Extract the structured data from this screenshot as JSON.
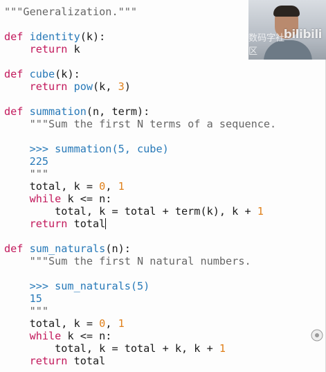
{
  "code_lines": [
    {
      "tokens": [
        {
          "c": "str",
          "t": "\"\"\"Generalization.\"\"\""
        }
      ]
    },
    {
      "tokens": []
    },
    {
      "tokens": [
        {
          "c": "kw",
          "t": "def "
        },
        {
          "c": "fn",
          "t": "identity"
        },
        {
          "c": "plain",
          "t": "(k):"
        }
      ]
    },
    {
      "tokens": [
        {
          "c": "kw",
          "t": "    return "
        },
        {
          "c": "plain",
          "t": "k"
        }
      ]
    },
    {
      "tokens": []
    },
    {
      "tokens": [
        {
          "c": "kw",
          "t": "def "
        },
        {
          "c": "fn",
          "t": "cube"
        },
        {
          "c": "plain",
          "t": "(k):"
        }
      ]
    },
    {
      "tokens": [
        {
          "c": "kw",
          "t": "    return "
        },
        {
          "c": "fn",
          "t": "pow"
        },
        {
          "c": "plain",
          "t": "(k, "
        },
        {
          "c": "num",
          "t": "3"
        },
        {
          "c": "plain",
          "t": ")"
        }
      ]
    },
    {
      "tokens": []
    },
    {
      "tokens": [
        {
          "c": "kw",
          "t": "def "
        },
        {
          "c": "fn",
          "t": "summation"
        },
        {
          "c": "plain",
          "t": "(n, term):"
        }
      ]
    },
    {
      "tokens": [
        {
          "c": "str",
          "t": "    \"\"\"Sum the first N terms of a sequence."
        }
      ]
    },
    {
      "tokens": []
    },
    {
      "tokens": [
        {
          "c": "dt",
          "t": "    >>> summation(5, cube)"
        }
      ]
    },
    {
      "tokens": [
        {
          "c": "dt",
          "t": "    225"
        }
      ]
    },
    {
      "tokens": [
        {
          "c": "str",
          "t": "    \"\"\""
        }
      ]
    },
    {
      "tokens": [
        {
          "c": "plain",
          "t": "    total, k = "
        },
        {
          "c": "num",
          "t": "0"
        },
        {
          "c": "plain",
          "t": ", "
        },
        {
          "c": "num",
          "t": "1"
        }
      ]
    },
    {
      "tokens": [
        {
          "c": "kw",
          "t": "    while "
        },
        {
          "c": "plain",
          "t": "k <= n:"
        }
      ]
    },
    {
      "tokens": [
        {
          "c": "plain",
          "t": "        total, k = total + term(k), k + "
        },
        {
          "c": "num",
          "t": "1"
        }
      ]
    },
    {
      "tokens": [
        {
          "c": "kw",
          "t": "    return "
        },
        {
          "c": "plain",
          "t": "total"
        }
      ],
      "cursor": true
    },
    {
      "tokens": []
    },
    {
      "tokens": [
        {
          "c": "kw",
          "t": "def "
        },
        {
          "c": "fn",
          "t": "sum_naturals"
        },
        {
          "c": "plain",
          "t": "(n):"
        }
      ]
    },
    {
      "tokens": [
        {
          "c": "str",
          "t": "    \"\"\"Sum the first N natural numbers."
        }
      ]
    },
    {
      "tokens": []
    },
    {
      "tokens": [
        {
          "c": "dt",
          "t": "    >>> sum_naturals(5)"
        }
      ]
    },
    {
      "tokens": [
        {
          "c": "dt",
          "t": "    15"
        }
      ]
    },
    {
      "tokens": [
        {
          "c": "str",
          "t": "    \"\"\""
        }
      ]
    },
    {
      "tokens": [
        {
          "c": "plain",
          "t": "    total, k = "
        },
        {
          "c": "num",
          "t": "0"
        },
        {
          "c": "plain",
          "t": ", "
        },
        {
          "c": "num",
          "t": "1"
        }
      ]
    },
    {
      "tokens": [
        {
          "c": "kw",
          "t": "    while "
        },
        {
          "c": "plain",
          "t": "k <= n:"
        }
      ]
    },
    {
      "tokens": [
        {
          "c": "plain",
          "t": "        total, k = total + k, k + "
        },
        {
          "c": "num",
          "t": "1"
        }
      ]
    },
    {
      "tokens": [
        {
          "c": "kw",
          "t": "    return "
        },
        {
          "c": "plain",
          "t": "total"
        }
      ]
    }
  ],
  "overlay": {
    "watermark_cn": "数码字社区",
    "watermark_brand": "bilibili",
    "webcam_label": "presenter-webcam"
  },
  "colors": {
    "keyword": "#c2185b",
    "function": "#2779b8",
    "string": "#666666",
    "number": "#e0801a"
  }
}
